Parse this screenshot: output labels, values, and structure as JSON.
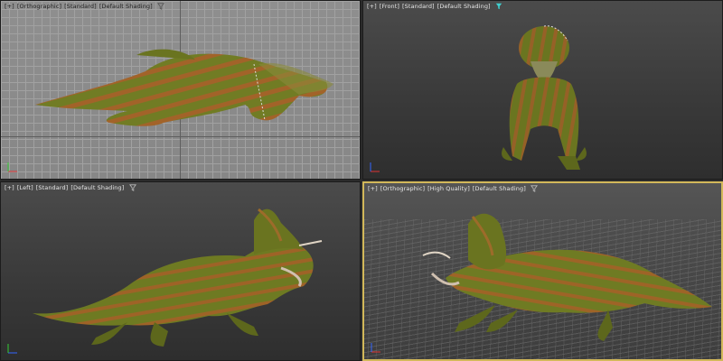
{
  "viewports": [
    {
      "id": "top",
      "labels": [
        "[+]",
        "[Orthographic]",
        "[Standard]",
        "[Default Shading]"
      ],
      "filter_icon": "filter-icon"
    },
    {
      "id": "front",
      "labels": [
        "[+]",
        "[Front]",
        "[Standard]",
        "[Default Shading]"
      ],
      "filter_icon": "filter-icon-active"
    },
    {
      "id": "left",
      "labels": [
        "[+]",
        "[Left]",
        "[Standard]",
        "[Default Shading]"
      ],
      "filter_icon": "filter-icon"
    },
    {
      "id": "persp",
      "labels": [
        "[+]",
        "[Orthographic]",
        "[High Quality]",
        "[Default Shading]"
      ],
      "filter_icon": "filter-icon"
    }
  ],
  "colors": {
    "active_border": "#d2b85a",
    "skin_base": "#6f7a22",
    "skin_stripes": "#b55a2a",
    "filter_active": "#3fd0d0"
  }
}
